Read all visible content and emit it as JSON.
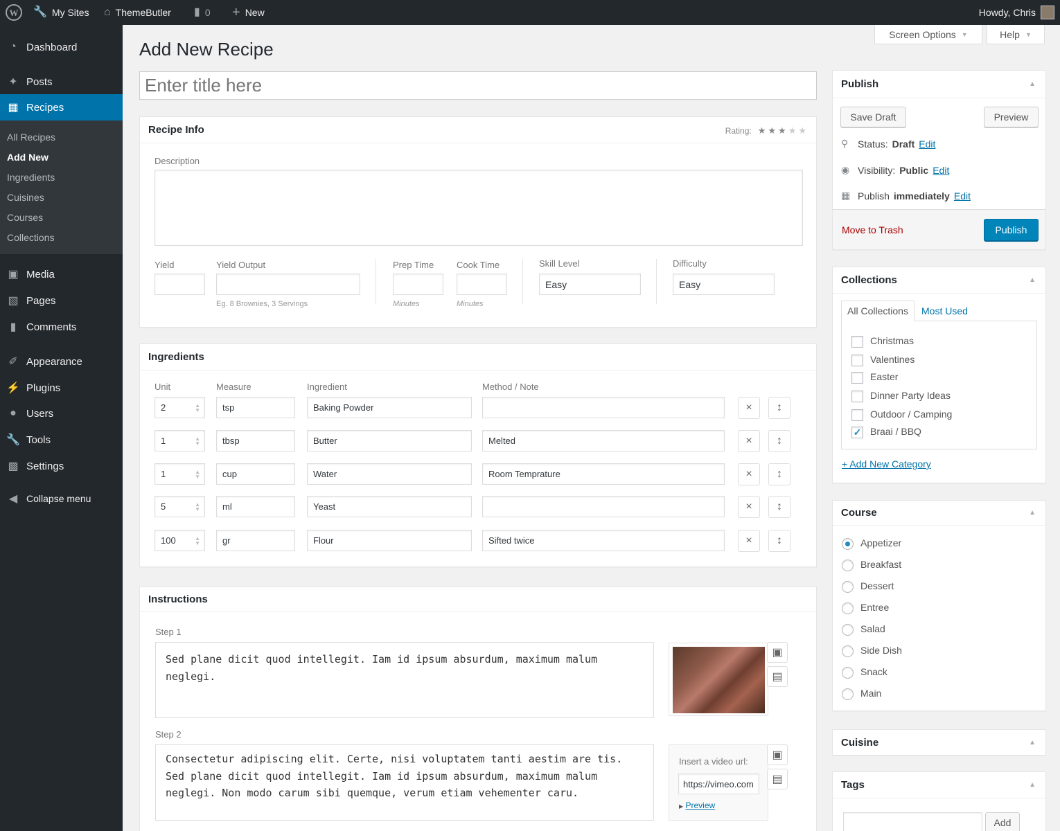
{
  "adminbar": {
    "my_sites": "My Sites",
    "site_name": "ThemeButler",
    "comments_count": "0",
    "new_label": "New",
    "howdy": "Howdy, Chris"
  },
  "sidebar": {
    "dashboard": "Dashboard",
    "posts": "Posts",
    "recipes": "Recipes",
    "recipes_sub": [
      "All Recipes",
      "Add New",
      "Ingredients",
      "Cuisines",
      "Courses",
      "Collections"
    ],
    "media": "Media",
    "pages": "Pages",
    "comments": "Comments",
    "appearance": "Appearance",
    "plugins": "Plugins",
    "users": "Users",
    "tools": "Tools",
    "settings": "Settings",
    "collapse": "Collapse menu"
  },
  "screen_options": "Screen Options",
  "help": "Help",
  "page_title": "Add New Recipe",
  "title_placeholder": "Enter title here",
  "recipe_info": {
    "heading": "Recipe Info",
    "rating_label": "Rating:",
    "rating": 3,
    "rating_max": 5,
    "description_label": "Description",
    "yield_label": "Yield",
    "yield_output_label": "Yield Output",
    "yield_output_hint": "Eg. 8 Brownies, 3 Servings",
    "prep_time_label": "Prep Time",
    "cook_time_label": "Cook Time",
    "minutes_hint": "Minutes",
    "skill_level_label": "Skill Level",
    "skill_level": "Easy",
    "difficulty_label": "Difficulty",
    "difficulty": "Easy"
  },
  "ingredients": {
    "heading": "Ingredients",
    "columns": [
      "Unit",
      "Measure",
      "Ingredient",
      "Method / Note"
    ],
    "rows": [
      {
        "unit": "2",
        "measure": "tsp",
        "ingredient": "Baking Powder",
        "note": ""
      },
      {
        "unit": "1",
        "measure": "tbsp",
        "ingredient": "Butter",
        "note": "Melted"
      },
      {
        "unit": "1",
        "measure": "cup",
        "ingredient": "Water",
        "note": "Room Temprature"
      },
      {
        "unit": "5",
        "measure": "ml",
        "ingredient": "Yeast",
        "note": ""
      },
      {
        "unit": "100",
        "measure": "gr",
        "ingredient": "Flour",
        "note": "Sifted twice"
      }
    ]
  },
  "instructions": {
    "heading": "Instructions",
    "step1_label": "Step 1",
    "step1_text": "Sed plane dicit quod intellegit. Iam id ipsum absurdum, maximum malum neglegi.",
    "step2_label": "Step 2",
    "step2_text": "Consectetur adipiscing elit. Certe, nisi voluptatem tanti aestim are tis. Sed plane dicit quod intellegit. Iam id ipsum absurdum, maximum malum neglegi. Non modo carum sibi quemque, verum etiam vehementer caru.",
    "video_label": "Insert a video url:",
    "video_url": "https://vimeo.com",
    "preview": "Preview"
  },
  "publish": {
    "heading": "Publish",
    "save_draft": "Save Draft",
    "preview": "Preview",
    "status_label": "Status:",
    "status_value": "Draft",
    "visibility_label": "Visibility:",
    "visibility_value": "Public",
    "publish_label": "Publish",
    "publish_value": "immediately",
    "edit": "Edit",
    "trash": "Move to Trash",
    "publish_button": "Publish"
  },
  "collections": {
    "heading": "Collections",
    "tab_all": "All Collections",
    "tab_most_used": "Most Used",
    "items": [
      {
        "label": "Christmas",
        "checked": false
      },
      {
        "label": "Valentines",
        "checked": false
      },
      {
        "label": "Easter",
        "checked": false
      },
      {
        "label": "Dinner Party Ideas",
        "checked": false
      },
      {
        "label": "Outdoor / Camping",
        "checked": false
      },
      {
        "label": "Braai / BBQ",
        "checked": true
      }
    ],
    "add_new": "+ Add New Category"
  },
  "course": {
    "heading": "Course",
    "selected": "Appetizer",
    "options": [
      "Appetizer",
      "Breakfast",
      "Dessert",
      "Entree",
      "Salad",
      "Side Dish",
      "Snack",
      "Main"
    ]
  },
  "cuisine": {
    "heading": "Cuisine"
  },
  "tags": {
    "heading": "Tags",
    "add": "Add"
  },
  "colors": {
    "primary": "#0085ba",
    "sidebar": "#23282d",
    "current": "#0073aa",
    "trash": "#a00"
  }
}
